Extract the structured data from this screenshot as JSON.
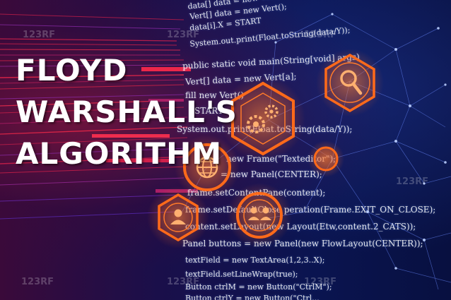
{
  "title_lines": [
    "FLOYD",
    "WARSHALL'S",
    "ALGORITHM"
  ],
  "watermark": "123RF",
  "code_lines": [
    "data[] data = new Vert[a];",
    "Vert[] data = new Vert();",
    "data[i].X = START",
    "System.out.print(Float.toString(data/Y));",
    "public static void main(String[void] args)",
    "Vert[] data = new Vert[a];",
    "fill new Vert()",
    "START",
    "System.out.print(Float.toString(data/Y));",
    "new Frame(\"Texteditor\");",
    "= new Panel(CENTER);",
    "frame.setContentPane(content);",
    "frame.setDefaultClose  peration(Frame.EXIT_ON_CLOSE);",
    "content.setLayout(new   Layout(Etw,content.2_CATS));",
    "Panel buttons = new Panel(new FlowLayout(CENTER));",
    "textField = new TextArea(1,2,3..X);",
    "textField.setLineWrap(true);",
    "Button ctrlM = new Button(\"CtrlM\");",
    "Button ctrlY = new Button(\"Ctrl..."
  ],
  "icons": [
    "gears-icon",
    "magnifier-icon",
    "globe-icon",
    "user-icon",
    "people-icon"
  ],
  "colors": {
    "accent_orange": "#ff6a1a",
    "background_navy": "#0a0f3a",
    "stripe_red": "#d0204a",
    "text_white": "#ffffff"
  }
}
